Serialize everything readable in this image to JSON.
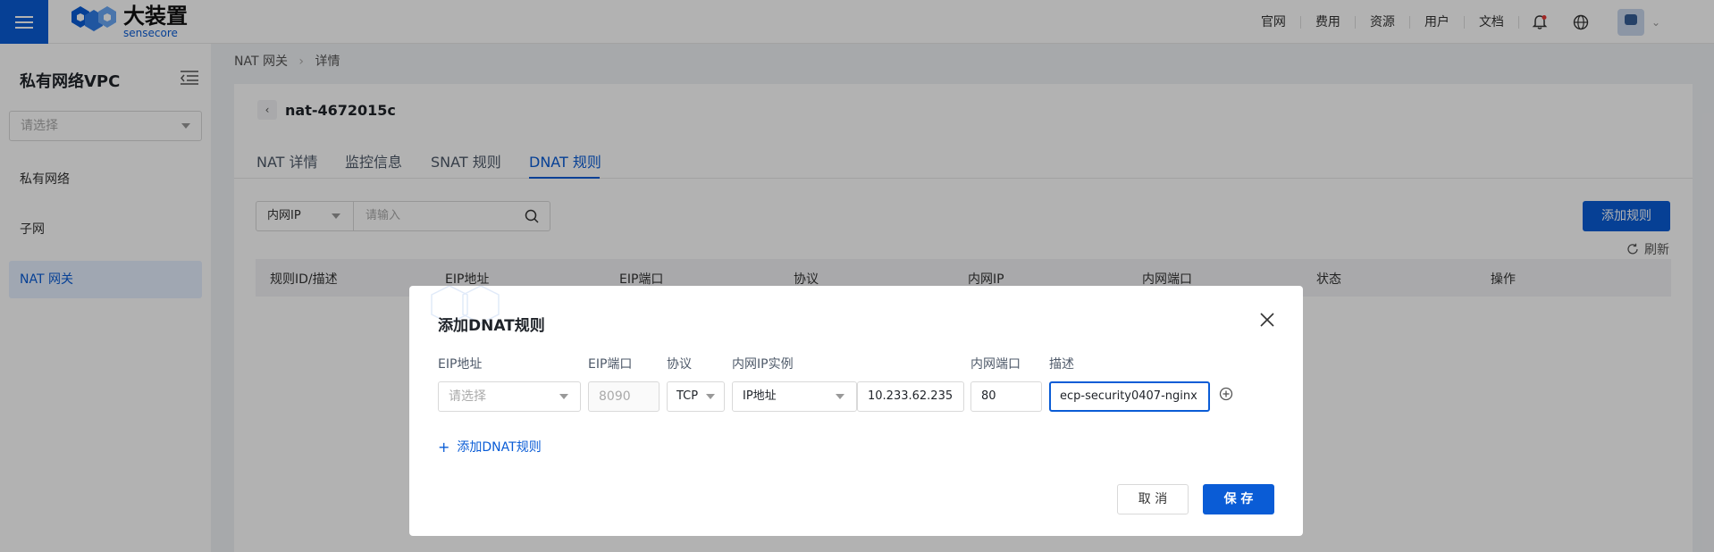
{
  "brand": {
    "name_cn": "大装置",
    "name_en": "sensecore"
  },
  "topnav": {
    "links": [
      "官网",
      "费用",
      "资源",
      "用户",
      "文档"
    ]
  },
  "sidebar": {
    "title": "私有网络VPC",
    "select_placeholder": "请选择",
    "items": [
      {
        "label": "私有网络",
        "active": false
      },
      {
        "label": "子网",
        "active": false
      },
      {
        "label": "NAT 网关",
        "active": true
      }
    ]
  },
  "breadcrumb": {
    "parent": "NAT 网关",
    "current": "详情"
  },
  "detail": {
    "title": "nat-4672015c",
    "tabs": [
      {
        "label": "NAT 详情",
        "active": false
      },
      {
        "label": "监控信息",
        "active": false
      },
      {
        "label": "SNAT 规则",
        "active": false
      },
      {
        "label": "DNAT 规则",
        "active": true
      }
    ],
    "filter": {
      "field": "内网IP",
      "placeholder": "请输入"
    },
    "add_rule_button": "添加规则",
    "refresh_label": "刷新",
    "table_headers": [
      "规则ID/描述",
      "EIP地址",
      "EIP端口",
      "协议",
      "内网IP",
      "内网端口",
      "状态",
      "操作"
    ]
  },
  "modal": {
    "title": "添加DNAT规则",
    "labels": {
      "eip": "EIP地址",
      "eip_port": "EIP端口",
      "protocol": "协议",
      "instance": "内网IP实例",
      "inner_port": "内网端口",
      "desc": "描述"
    },
    "fields": {
      "eip_placeholder": "请选择",
      "eip_port_placeholder": "8090",
      "protocol": "TCP",
      "instance_type": "IP地址",
      "inner_ip": "10.233.62.235",
      "inner_port": "80",
      "desc": "ecp-security0407-nginx"
    },
    "add_link": "添加DNAT规则",
    "cancel": "取 消",
    "save": "保 存"
  },
  "colors": {
    "primary": "#0a5cd6",
    "overlay": "rgba(0,0,0,0.30)"
  }
}
